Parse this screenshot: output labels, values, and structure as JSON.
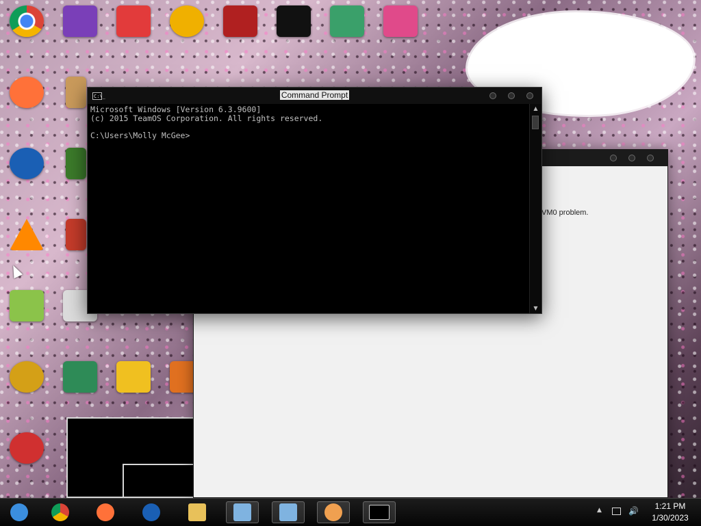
{
  "cmd": {
    "title": "Command Prompt",
    "lines": [
      "Microsoft Windows [Version 6.3.9600]",
      "(c) 2015 TeamOS Corporation. All rights reserved.",
      "",
      "C:\\Users\\Molly McGee>"
    ],
    "icon_label": "C:\\_"
  },
  "back_window": {
    "partial_text": "VM0 problem."
  },
  "taskbar": {
    "items": [
      {
        "name": "ie-icon",
        "color": "#3b8ede"
      },
      {
        "name": "chrome-icon",
        "color": "#db4437"
      },
      {
        "name": "firefox-icon",
        "color": "#ff7139"
      },
      {
        "name": "obama-logo-icon",
        "color": "#1a5fb4"
      },
      {
        "name": "folder-icon",
        "color": "#e8c15a"
      },
      {
        "name": "remote-desktop-icon",
        "color": "#7fb3e0"
      },
      {
        "name": "remote-desktop-icon-2",
        "color": "#7fb3e0"
      },
      {
        "name": "user-icon",
        "color": "#f0a050"
      },
      {
        "name": "cmd-icon",
        "color": "#000000"
      }
    ]
  },
  "tray": {
    "time": "1:21 PM",
    "date": "1/30/2023"
  },
  "colors": {
    "console_bg": "#000000",
    "console_fg": "#c0c0c0",
    "taskbar_bg": "#0c0c0c"
  }
}
